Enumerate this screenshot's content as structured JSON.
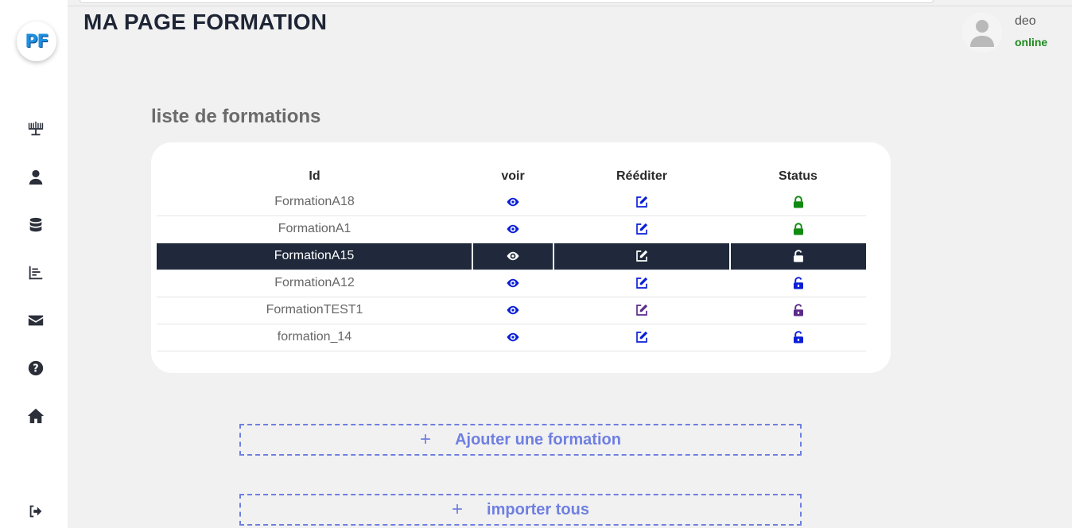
{
  "app": {
    "logo": "PF",
    "page_title": "MA PAGE FORMATION"
  },
  "user": {
    "name": "deo",
    "status": "online"
  },
  "sidebar": {
    "items": [
      {
        "icon": "menorah-icon"
      },
      {
        "icon": "user-icon"
      },
      {
        "icon": "database-icon"
      },
      {
        "icon": "chart-icon"
      },
      {
        "icon": "envelope-icon"
      },
      {
        "icon": "question-icon"
      },
      {
        "icon": "home-icon"
      },
      {
        "icon": "logout-icon"
      }
    ]
  },
  "section_title": "liste de formations",
  "table": {
    "headers": [
      "Id",
      "voir",
      "Rééditer",
      "Status"
    ],
    "rows": [
      {
        "id": "FormationA18",
        "status": "locked"
      },
      {
        "id": "FormationA1",
        "status": "locked"
      },
      {
        "id": "FormationA15",
        "status": "unlocked"
      },
      {
        "id": "FormationA12",
        "status": "unlocked"
      },
      {
        "id": "FormationTEST1",
        "status": "unlocked"
      },
      {
        "id": "formation_14",
        "status": "unlocked"
      }
    ]
  },
  "actions": {
    "add_label": "Ajouter une formation",
    "import_label": "importer tous",
    "plus": "+"
  },
  "colors": {
    "accent": "#6f7fe0",
    "icon_blue": "#0a1ed6",
    "lock_green": "#118a11",
    "visited_purple": "#5b2a8a",
    "active_row": "#1f293b"
  }
}
